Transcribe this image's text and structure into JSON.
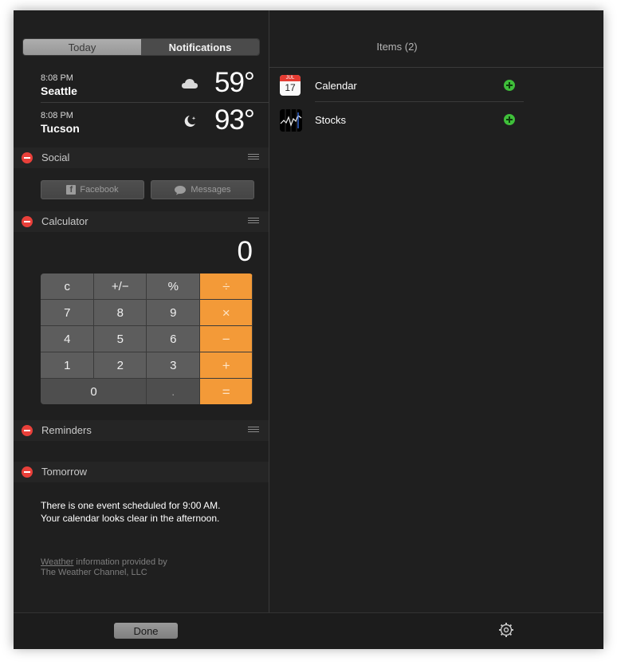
{
  "tabs": {
    "today": "Today",
    "notifications": "Notifications"
  },
  "weather": [
    {
      "time": "8:08 PM",
      "city": "Seattle",
      "temp": "59°",
      "icon": "cloud-icon"
    },
    {
      "time": "8:08 PM",
      "city": "Tucson",
      "temp": "93°",
      "icon": "moon-icon"
    }
  ],
  "social": {
    "title": "Social",
    "facebook": "Facebook",
    "messages": "Messages"
  },
  "calculator": {
    "title": "Calculator",
    "display": "0",
    "keys": [
      "c",
      "+/−",
      "%",
      "÷",
      "7",
      "8",
      "9",
      "×",
      "4",
      "5",
      "6",
      "−",
      "1",
      "2",
      "3",
      "+",
      "0",
      ".",
      "="
    ]
  },
  "reminders": {
    "title": "Reminders"
  },
  "tomorrow": {
    "title": "Tomorrow",
    "line1": "There is one event scheduled for 9:00 AM.",
    "line2": "Your calendar looks clear in the afternoon.",
    "credit_link": "Weather",
    "credit_rest": " information provided by",
    "credit_line2": "The Weather Channel, LLC"
  },
  "items": {
    "title": "Items (2)",
    "list": [
      {
        "label": "Calendar",
        "icon": "calendar-icon",
        "month": "JUL",
        "day": "17"
      },
      {
        "label": "Stocks",
        "icon": "stocks-icon"
      }
    ]
  },
  "footer": {
    "done": "Done"
  },
  "colors": {
    "accent_orange": "#f39a38",
    "remove_red": "#e9403a",
    "add_green": "#3fbf3a"
  }
}
